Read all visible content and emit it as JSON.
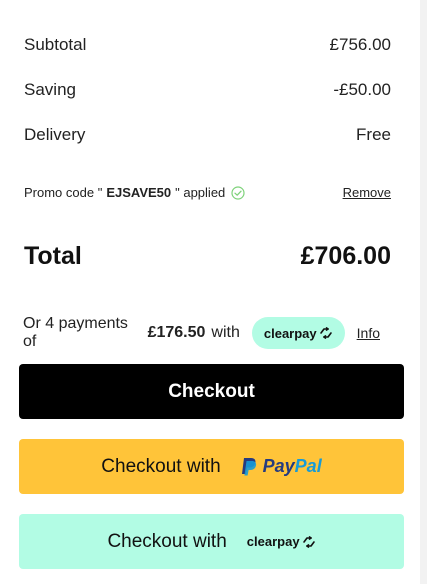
{
  "summary": {
    "subtotal_label": "Subtotal",
    "subtotal_value": "£756.00",
    "saving_label": "Saving",
    "saving_value": "-£50.00",
    "delivery_label": "Delivery",
    "delivery_value": "Free"
  },
  "promo": {
    "prefix": "Promo code \"",
    "code": "EJSAVE50",
    "suffix": "\" applied",
    "remove_label": "Remove",
    "status_icon": "check-circle-icon",
    "status_color": "#7ed27a"
  },
  "total": {
    "label": "Total",
    "value": "£706.00"
  },
  "installments": {
    "prefix": "Or 4 payments of",
    "amount": "£176.50",
    "suffix": "with",
    "provider": "clearpay",
    "info_label": "Info",
    "pill_color": "#b2fce4"
  },
  "buttons": {
    "checkout_label": "Checkout",
    "paypal_prefix": "Checkout with",
    "paypal_brand_pay": "Pay",
    "paypal_brand_pal": "Pal",
    "clearpay_prefix": "Checkout with",
    "clearpay_brand": "clearpay",
    "checkout_color": "#000000",
    "paypal_color": "#ffc439",
    "clearpay_color": "#b2fce4"
  }
}
